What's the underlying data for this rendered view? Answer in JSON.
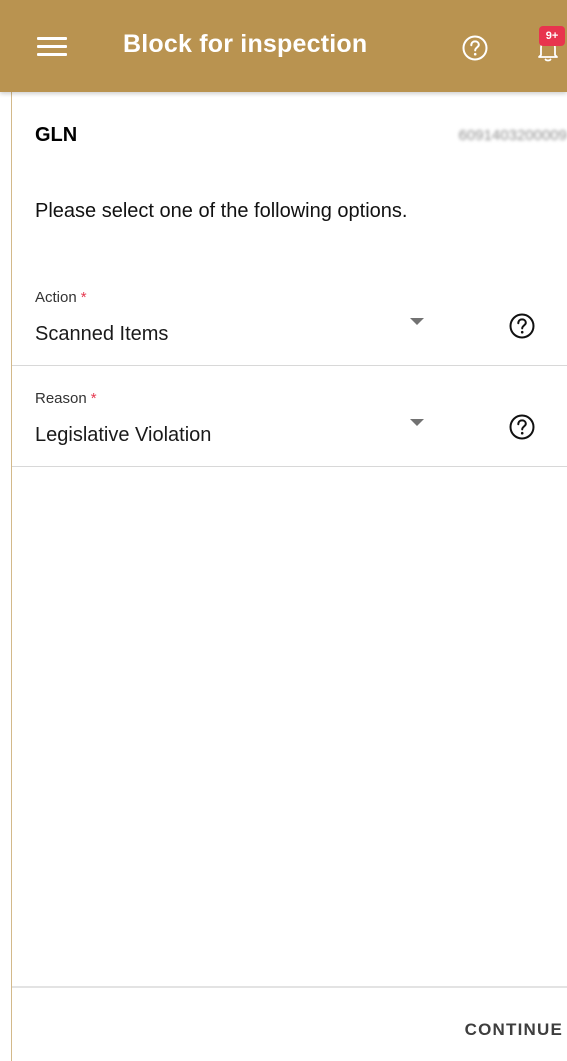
{
  "header": {
    "title": "Block for inspection",
    "menu_icon": "menu-icon",
    "help_icon": "help-circle-icon",
    "notification_icon": "bell-icon",
    "notification_badge": "9+",
    "background_color": "#b99350",
    "badge_color": "#e8344e"
  },
  "gln": {
    "label": "GLN",
    "value": "6091403200009"
  },
  "instruction": "Please select one of the following options.",
  "form": {
    "required_marker": "*",
    "action": {
      "label": "Action",
      "value": "Scanned Items"
    },
    "reason": {
      "label": "Reason",
      "value": "Legislative Violation"
    }
  },
  "footer": {
    "continue_label": "CONTINUE"
  }
}
